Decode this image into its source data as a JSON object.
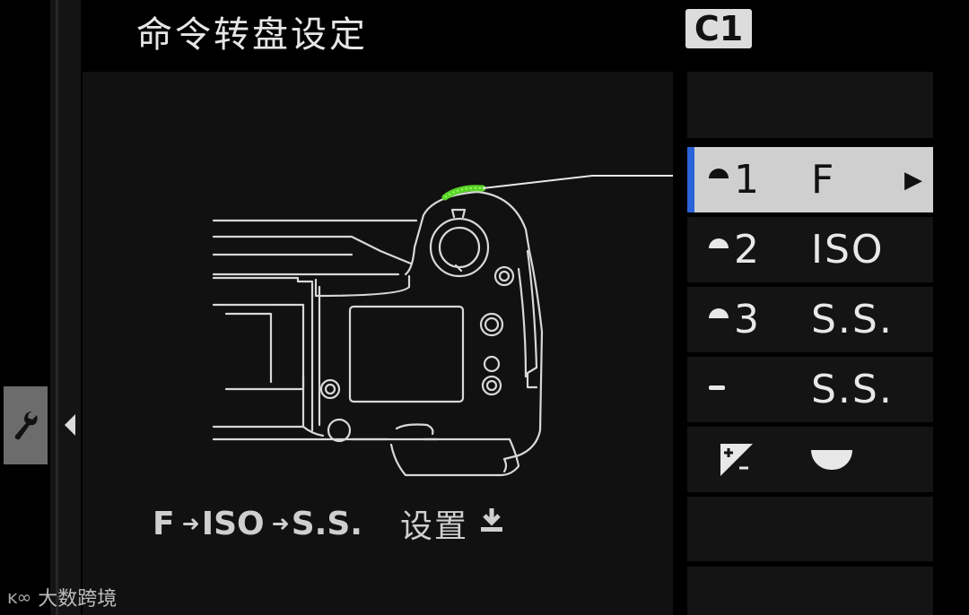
{
  "header": {
    "title": "命令转盘设定",
    "custom_badge": "C1"
  },
  "preview": {
    "caption": {
      "seq_1": "F",
      "arrow": "➜",
      "seq_2": "ISO",
      "seq_3": "S.S.",
      "set_label": "设置",
      "set_icon": "download-arrow-icon"
    }
  },
  "menu": {
    "rows": [
      {
        "dial_icon": "dial-rear-icon",
        "num": "1",
        "value": "F",
        "selected": true,
        "chevron": "▶"
      },
      {
        "dial_icon": "dial-rear-icon",
        "num": "2",
        "value": "ISO",
        "selected": false
      },
      {
        "dial_icon": "dial-rear-icon",
        "num": "3",
        "value": "S.S.",
        "selected": false
      },
      {
        "dial_icon": "dial-flat-icon",
        "num": "",
        "value": "S.S.",
        "selected": false
      },
      {
        "dial_icon": "exposure-compensation-icon",
        "num": "",
        "value": "",
        "value_icon": "half-dial-icon",
        "selected": false
      }
    ],
    "accent_color": "#2a63d8"
  },
  "sidebar": {
    "active_icon": "wrench-icon",
    "collapse_icon": "triangle-left-icon"
  },
  "watermark": {
    "logo": "ĸ∞",
    "text": "大数跨境"
  },
  "colors": {
    "background": "#000000",
    "panel": "#141414",
    "selected_row": "#cfcfcf",
    "dial_highlight": "#5ad428"
  }
}
